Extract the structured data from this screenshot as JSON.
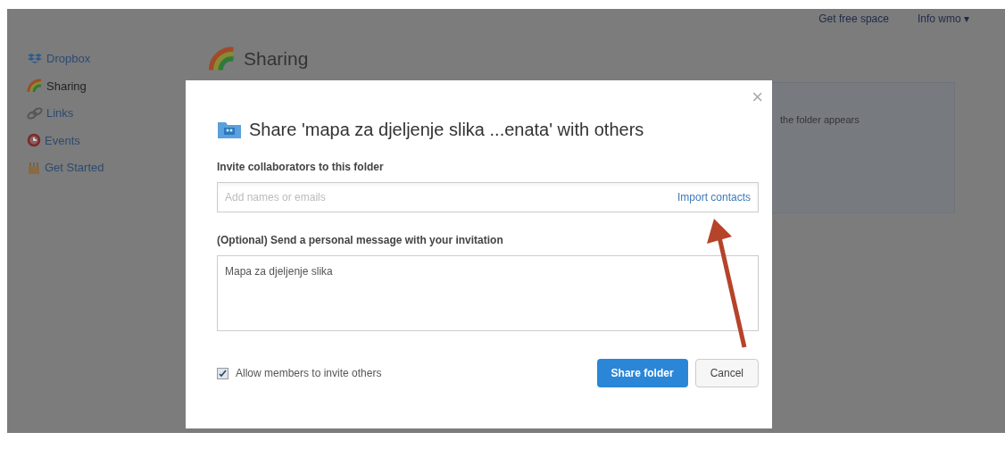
{
  "top_bar": {
    "links": [
      "Get free space",
      "Info wmo ▾"
    ]
  },
  "sidebar": {
    "items": [
      {
        "label": "Dropbox",
        "selected": false
      },
      {
        "label": "Sharing",
        "selected": true
      },
      {
        "label": "Links",
        "selected": false
      },
      {
        "label": "Events",
        "selected": false
      },
      {
        "label": "Get Started",
        "selected": false
      }
    ]
  },
  "page": {
    "title": "Sharing",
    "panel_text": "the folder appears"
  },
  "dialog": {
    "close": "×",
    "title": "Share 'mapa za djeljenje slika ...enata' with others",
    "invite_label": "Invite collaborators to this folder",
    "invite_field": {
      "placeholder": "Add names or emails"
    },
    "import_link": "Import contacts",
    "message_label": "(Optional) Send a personal message with your invitation",
    "message_field": {
      "value": "Mapa za djeljenje slika"
    },
    "allow_checkbox": {
      "label": "Allow members to invite others",
      "checked": true
    },
    "buttons": [
      {
        "label": "Share folder",
        "kind": "primary"
      },
      {
        "label": "Cancel",
        "kind": "secondary"
      }
    ]
  }
}
